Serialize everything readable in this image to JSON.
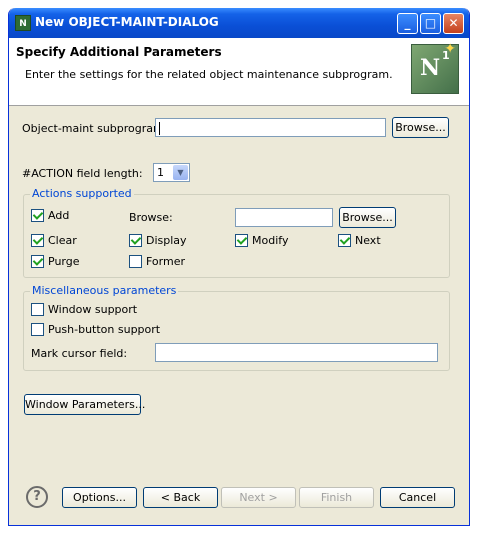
{
  "window": {
    "title": "New OBJECT-MAINT-DIALOG",
    "title_icon": "N",
    "buttons": {
      "minimize": "_",
      "maximize": "□",
      "close": "✕"
    }
  },
  "header": {
    "title": "Specify Additional Parameters",
    "description": "Enter the settings for the related object maintenance subprogram.",
    "logo_text": "N",
    "logo_sup": "1"
  },
  "form": {
    "subprogram_label": "Object-maint subprogram:",
    "subprogram_value": "",
    "browse_label": "Browse...",
    "action_length_label": "#ACTION field length:",
    "action_length_value": "1"
  },
  "actions": {
    "title": "Actions supported",
    "browse_label": "Browse:",
    "browse_value": "",
    "browse_button": "Browse...",
    "items": [
      {
        "label": "Add",
        "checked": true
      },
      {
        "label": "Clear",
        "checked": true
      },
      {
        "label": "Display",
        "checked": true
      },
      {
        "label": "Modify",
        "checked": true
      },
      {
        "label": "Next",
        "checked": true
      },
      {
        "label": "Purge",
        "checked": true
      },
      {
        "label": "Former",
        "checked": false
      }
    ]
  },
  "misc": {
    "title": "Miscellaneous parameters",
    "window_support": {
      "label": "Window support",
      "checked": false
    },
    "push_button_support": {
      "label": "Push-button support",
      "checked": false
    },
    "mark_cursor_label": "Mark cursor field:",
    "mark_cursor_value": ""
  },
  "window_params_button": "Window Parameters...",
  "footer": {
    "help": "?",
    "options": "Options...",
    "back": "< Back",
    "next": "Next >",
    "finish": "Finish",
    "cancel": "Cancel"
  },
  "colors": {
    "titlebar": "#0a4fd6",
    "group_title": "#0046d5",
    "dialog_bg": "#ece9d8",
    "check_mark": "#21a121"
  }
}
